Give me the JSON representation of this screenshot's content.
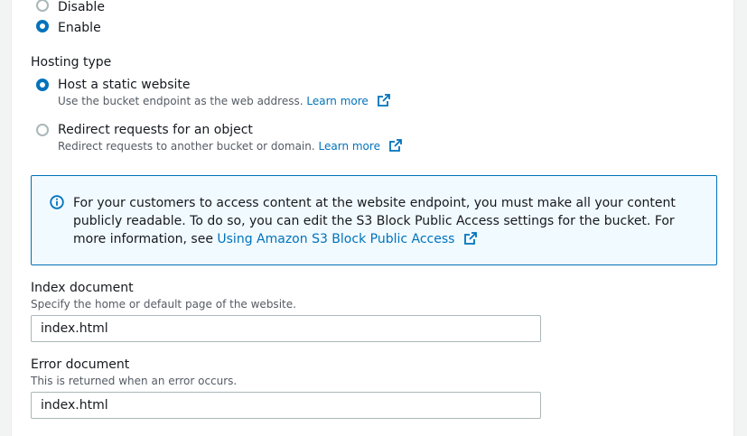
{
  "access": {
    "options": [
      {
        "label": "Disable",
        "selected": false
      },
      {
        "label": "Enable",
        "selected": true
      }
    ]
  },
  "hosting": {
    "title": "Hosting type",
    "static": {
      "label": "Host a static website",
      "desc": "Use the bucket endpoint as the web address.",
      "link": "Learn more",
      "selected": true
    },
    "redirect": {
      "label": "Redirect requests for an object",
      "desc": "Redirect requests to another bucket or domain.",
      "link": "Learn more",
      "selected": false
    }
  },
  "alert": {
    "icon": "info-icon",
    "text": "For your customers to access content at the website endpoint, you must make all your content publicly readable. To do so, you can edit the S3 Block Public Access settings for the bucket. For more information, see",
    "link": "Using Amazon S3 Block Public Access"
  },
  "index_doc": {
    "label": "Index document",
    "desc": "Specify the home or default page of the website.",
    "value": "index.html"
  },
  "error_doc": {
    "label": "Error document",
    "desc": "This is returned when an error occurs.",
    "value": "index.html"
  },
  "colors": {
    "link": "#0073bb",
    "alert_bg": "#f1faff",
    "alert_border": "#0073bb",
    "text": "#16191f",
    "muted": "#545b64"
  }
}
